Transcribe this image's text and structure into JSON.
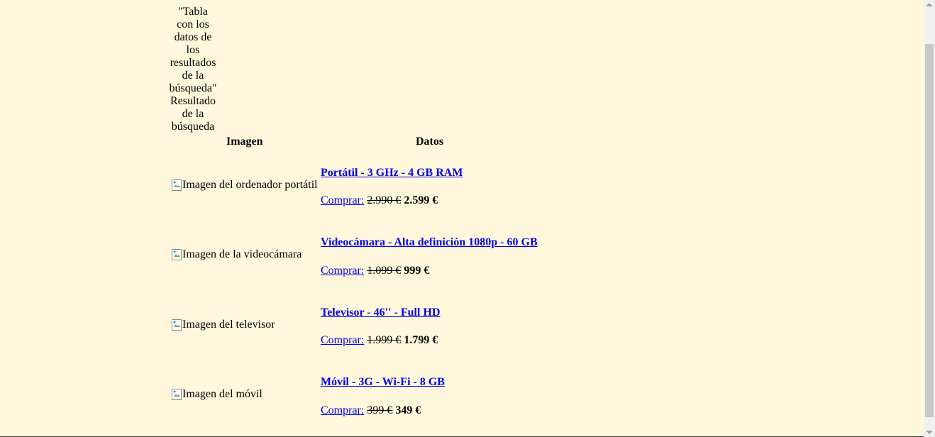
{
  "table": {
    "caption": "\"Tabla con los datos de los resultados de la búsqueda\" Resultado de la búsqueda",
    "headers": {
      "image": "Imagen",
      "data": "Datos"
    },
    "buy_label": "Comprar:",
    "products": [
      {
        "alt": "Imagen del ordenador portátil",
        "title": "Portátil - 3 GHz - 4 GB RAM",
        "old_price": "2.990 €",
        "new_price": "2.599 €"
      },
      {
        "alt": "Imagen de la videocámara",
        "title": "Videocámara - Alta definición 1080p - 60 GB",
        "old_price": "1.099 €",
        "new_price": "999 €"
      },
      {
        "alt": "Imagen del televisor",
        "title": "Televisor - 46'' - Full HD",
        "old_price": "1.999 €",
        "new_price": "1.799 €"
      },
      {
        "alt": "Imagen del móvil",
        "title": "Móvil - 3G - Wi-Fi - 8 GB",
        "old_price": "399 €",
        "new_price": "349 €"
      }
    ]
  }
}
